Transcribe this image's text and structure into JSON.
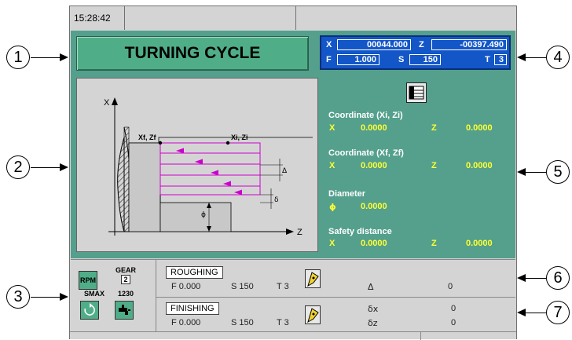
{
  "time": "15:28:42",
  "title": "TURNING CYCLE",
  "callouts": [
    "1",
    "2",
    "3",
    "4",
    "5",
    "6",
    "7"
  ],
  "coord_display": {
    "x_label": "X",
    "x_value": "00044.000",
    "z_label": "Z",
    "z_value": "-00397.490",
    "f_label": "F",
    "f_value": "1.000",
    "s_label": "S",
    "s_value": "150",
    "t_label": "T",
    "t_value": "3"
  },
  "diagram": {
    "axis_x": "X",
    "axis_z": "Z",
    "xf_zf": "Xf, Zf",
    "xi_zi": "Xi, Zi",
    "delta": "Δ",
    "small_delta": "δ",
    "phi": "ϕ"
  },
  "params": {
    "initial": {
      "label": "Coordinate  (Xi, Zi)",
      "x_lab": "X",
      "x_val": "0.0000",
      "z_lab": "Z",
      "z_val": "0.0000"
    },
    "final": {
      "label": "Coordinate  (Xf, Zf)",
      "x_lab": "X",
      "x_val": "0.0000",
      "z_lab": "Z",
      "z_val": "0.0000"
    },
    "diameter": {
      "label": "Diameter",
      "sym": "ϕ",
      "val": "0.0000"
    },
    "safety": {
      "label": "Safety distance",
      "x_lab": "X",
      "x_val": "0.0000",
      "z_lab": "Z",
      "z_val": "0.0000"
    }
  },
  "spindle": {
    "rpm": "RPM",
    "gear_label": "GEAR",
    "gear_value": "2",
    "smax_label": "SMAX",
    "smax_value": "1230"
  },
  "roughing": {
    "label": "ROUGHING",
    "f": "F 0.000",
    "s": "S 150",
    "t": "T 3",
    "delta_label": "Δ",
    "delta_value": "0"
  },
  "finishing": {
    "label": "FINISHING",
    "f": "F 0.000",
    "s": "S 150",
    "t": "T 3",
    "dx_label": "δx",
    "dx_value": "0",
    "dz_label": "δz",
    "dz_value": "0"
  },
  "colors": {
    "panel_green": "#54a08c",
    "title_green": "#4fae88",
    "coord_blue": "#1356c8",
    "value_yellow": "#ffff33",
    "path_magenta": "#cc00cc"
  }
}
